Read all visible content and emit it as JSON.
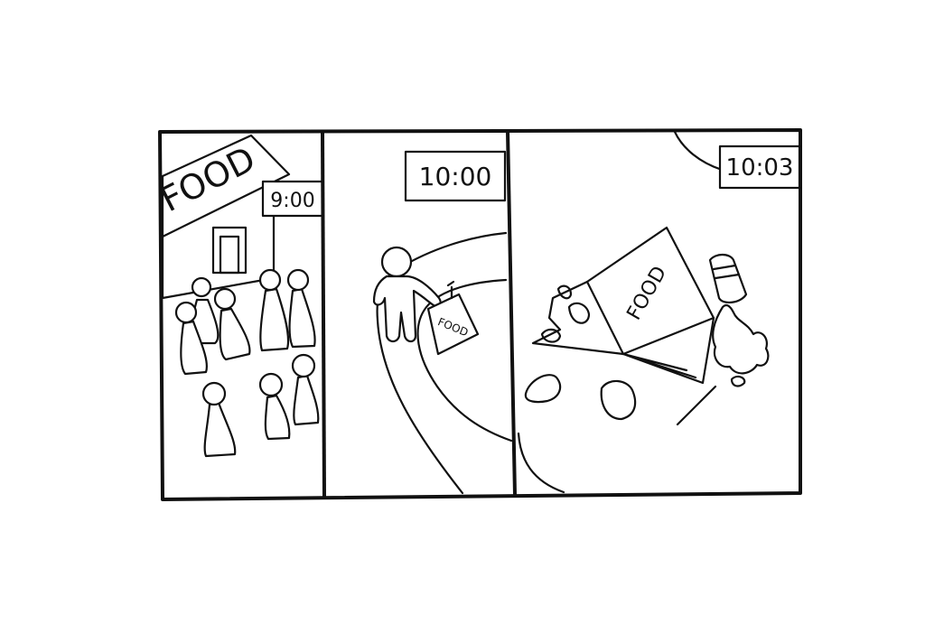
{
  "panels": [
    {
      "clock": "9:00",
      "sign": "FOOD"
    },
    {
      "clock": "10:00",
      "bag_label": "FOOD"
    },
    {
      "clock": "10:03",
      "box_label": "FOOD"
    }
  ]
}
